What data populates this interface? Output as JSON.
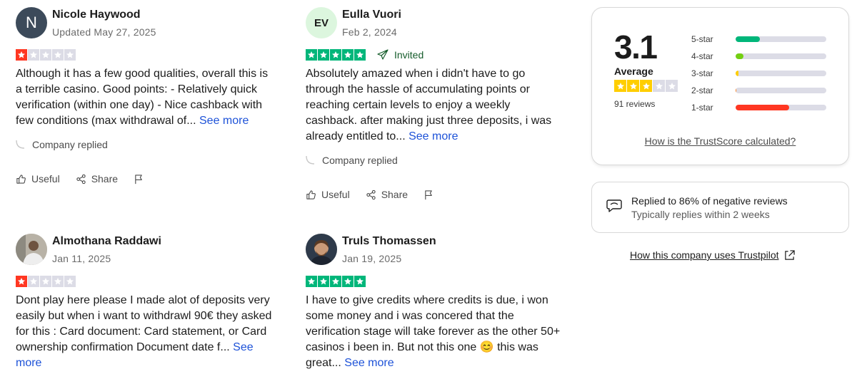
{
  "reviews": [
    {
      "name": "Nicole Haywood",
      "date": "Updated May 27, 2025",
      "avatar_initials": "N",
      "rating": 1,
      "text": "Although it has a few good qualities, overall this is a terrible casino. Good points: - Relatively quick verification (within one day) - Nice cashback with few conditions (max withdrawal of...",
      "see_more": "See more",
      "company_replied": "Company replied",
      "useful": "Useful",
      "share": "Share"
    },
    {
      "name": "Eulla Vuori",
      "date": "Feb 2, 2024",
      "avatar_initials": "EV",
      "rating": 5,
      "invited": "Invited",
      "text": "Absolutely amazed when i didn't have to go through the hassle of accumulating points or reaching certain levels to enjoy a weekly cashback. after making just three deposits, i was already entitled to...",
      "see_more": "See more",
      "company_replied": "Company replied",
      "useful": "Useful",
      "share": "Share"
    },
    {
      "name": "Almothana Raddawi",
      "date": "Jan 11, 2025",
      "rating": 1,
      "text": "Dont play here please I made alot of deposits very easily but when i want to withdrawl 90€ they asked for this : Card document: Card statement, or Card ownership confirmation Document date f...",
      "see_more": "See more"
    },
    {
      "name": "Truls Thomassen",
      "date": "Jan 19, 2025",
      "rating": 5,
      "text": "I have to give credits where credits is due, i won some money and i was concered that the verification stage will take forever as the other 50+ casinos i been in. But not this one 😊 this was great...",
      "see_more": "See more"
    }
  ],
  "summary": {
    "score": "3.1",
    "label": "Average",
    "stars_filled": 3,
    "count": "91 reviews",
    "distribution": [
      {
        "label": "5-star",
        "fraction": 0.27,
        "color": "#00b67a"
      },
      {
        "label": "4-star",
        "fraction": 0.09,
        "color": "#73cf11"
      },
      {
        "label": "3-star",
        "fraction": 0.03,
        "color": "#ffce00"
      },
      {
        "label": "2-star",
        "fraction": 0.01,
        "color": "#ff8622"
      },
      {
        "label": "1-star",
        "fraction": 0.59,
        "color": "#ff3722"
      }
    ],
    "calc_link": "How is the TrustScore calculated?"
  },
  "reply_stats": {
    "line1": "Replied to 86% of negative reviews",
    "line2": "Typically replies within 2 weeks"
  },
  "uses_link": "How this company uses Trustpilot",
  "colors": {
    "star_red": "#ff3722",
    "star_green": "#00b67a",
    "star_yellow": "#ffce00",
    "star_empty": "#dcdce6",
    "link_blue": "#1d52d8"
  }
}
